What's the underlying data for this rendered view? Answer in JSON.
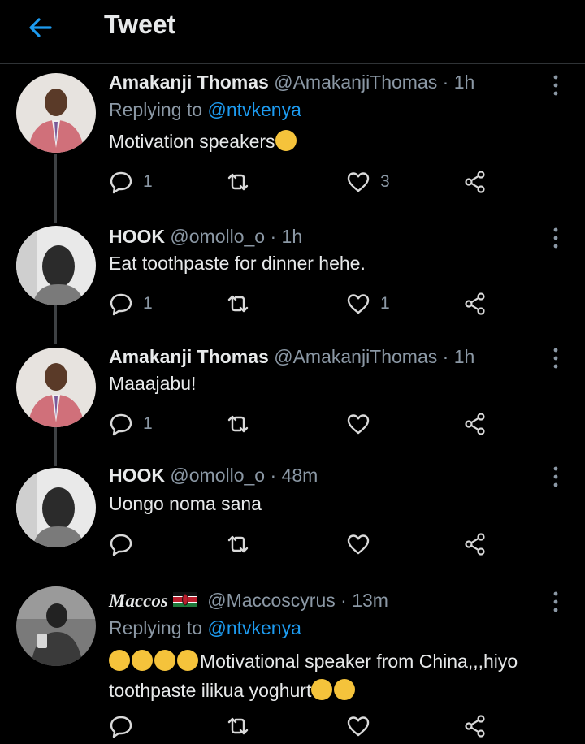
{
  "header": {
    "title": "Tweet",
    "back_icon": "arrow-left-icon",
    "accent": "#1d9bf0"
  },
  "tweets": [
    {
      "name": "Amakanji Thomas",
      "handle": "@AmakanjiThomas",
      "dot": "·",
      "time": "1h",
      "replying_prefix": "Replying to",
      "replying_to": "@ntvkenya",
      "text": "Motivation speakers",
      "reply_count": "1",
      "retweet_count": "",
      "like_count": "3"
    },
    {
      "name": "HOOK",
      "handle": "@omollo_o",
      "dot": "·",
      "time": "1h",
      "text": "Eat toothpaste for dinner hehe.",
      "reply_count": "1",
      "retweet_count": "",
      "like_count": "1"
    },
    {
      "name": "Amakanji Thomas",
      "handle": "@AmakanjiThomas",
      "dot": "·",
      "time": "1h",
      "text": "Maaajabu!",
      "reply_count": "1",
      "retweet_count": "",
      "like_count": ""
    },
    {
      "name": "HOOK",
      "handle": "@omollo_o",
      "dot": "·",
      "time": "48m",
      "text": "Uongo noma sana",
      "reply_count": "",
      "retweet_count": "",
      "like_count": ""
    },
    {
      "name": "Maccos",
      "handle": "@Maccoscyrus",
      "dot": "·",
      "time": "13m",
      "replying_prefix": "Replying to",
      "replying_to": "@ntvkenya",
      "text_line1": "Motivational speaker from China,,,hiyo",
      "text_line2": "toothpaste ilikua yoghurt",
      "reply_count": "",
      "retweet_count": "",
      "like_count": ""
    }
  ]
}
